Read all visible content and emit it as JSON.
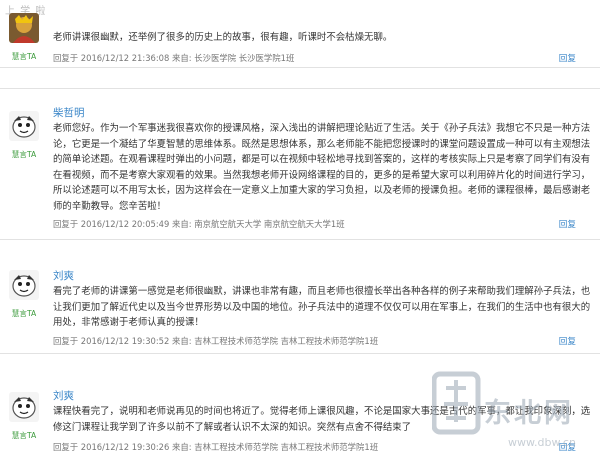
{
  "top_label": "上 学 啦",
  "posts": [
    {
      "author": "",
      "avatar_tag": "慧言TA",
      "text": "老师讲课很幽默，还举例了很多的历史上的故事，很有趣，听课时不会枯燥无聊。",
      "meta": "回复于 2016/12/12 21:36:08 来自: 长沙医学院 长沙医学院1班",
      "reply": "回复"
    },
    {
      "author": "柴哲明",
      "avatar_tag": "慧言TA",
      "text": "老师您好。作为一个军事迷我很喜欢你的授课风格，深入浅出的讲解把理论贴近了生活。关于《孙子兵法》我想它不只是一种方法论，它更是一个凝结了华夏智慧的思维体系。既然是思想体系，那么老师能不能把您授课时的课堂问题设置成一种可以有主观想法的简单论述题。在观看课程时弹出的小问题，都是可以在视频中轻松地寻找到答案的，这样的考核实际上只是考察了同学们有没有在看视频，而不是考察大家观看的效果。当然我想老师开设网络课程的目的，更多的是希望大家可以利用碎片化的时间进行学习，所以论述题可以不用写太长，因为这样会在一定意义上加重大家的学习负担，以及老师的授课负担。老师的课程很棒，最后感谢老师的辛勤教导。您辛苦啦！",
      "meta": "回复于 2016/12/12 20:05:49 来自: 南京航空航天大学 南京航空航天大学1班",
      "reply": "回复"
    },
    {
      "author": "刘爽",
      "avatar_tag": "慧言TA",
      "text": "看完了老师的讲课第一感觉是老师很幽默，讲课也非常有趣，而且老师也很擅长举出各种各样的例子来帮助我们理解孙子兵法，也让我们更加了解近代史以及当今世界形势以及中国的地位。孙子兵法中的道理不仅仅可以用在军事上，在我们的生活中也有很大的用处，非常感谢于老师认真的授课！",
      "meta": "回复于 2016/12/12 19:30:52 来自: 吉林工程技术师范学院 吉林工程技术师范学院1班",
      "reply": "回复"
    },
    {
      "author": "刘爽",
      "avatar_tag": "慧言TA",
      "text": "课程快看完了，说明和老师说再见的时间也将近了。觉得老师上课很风趣，不论是国家大事还是古代的军事，都让我印象深刻，选修这门课程让我学到了许多以前不了解或者认识不太深的知识。突然有点舍不得结束了",
      "meta": "回复于 2016/12/12 19:30:26 来自: 吉林工程技术师范学院 吉林工程技术师范学院1班",
      "reply": "回复"
    }
  ],
  "watermark": {
    "text": "东北网",
    "url": "www.dbw.cn"
  },
  "colors": {
    "link": "#3a86c8",
    "tag": "#3a9a3a",
    "divider": "#e2e2e2"
  }
}
